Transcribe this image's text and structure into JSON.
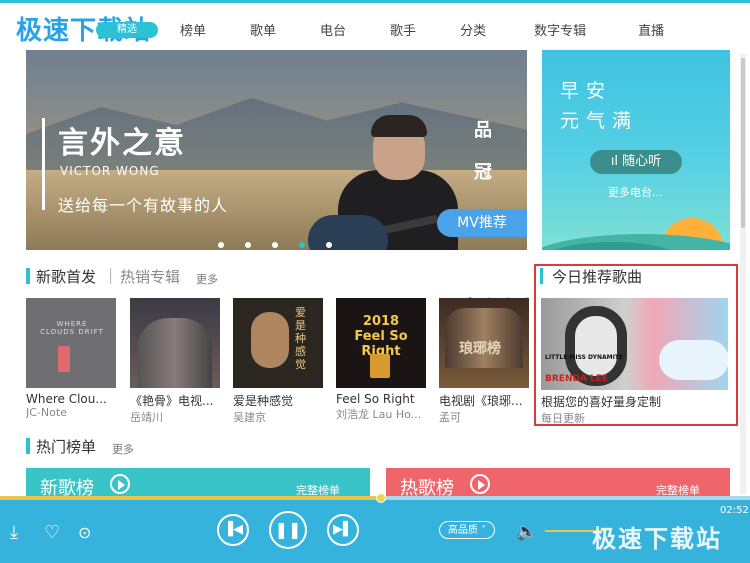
{
  "header": {
    "logo": "极速下载站",
    "logo_badge": "精选",
    "nav": [
      "榜单",
      "歌单",
      "电台",
      "歌手",
      "分类",
      "数字专辑",
      "直播"
    ]
  },
  "banner": {
    "title": "言外之意",
    "artist_en": "VICTOR WONG",
    "subtitle": "送给每一个有故事的人",
    "side_top": "品",
    "side_bottom": "冠",
    "badge": "MV推荐",
    "dots": 5,
    "active_dot": 4
  },
  "side_card": {
    "line1": "早安",
    "line2": "元气满",
    "button": "随心听",
    "more": "更多电台..."
  },
  "new_songs": {
    "tab_active": "新歌首发",
    "tab_inactive": "热销专辑",
    "more": "更多",
    "albums": [
      {
        "title": "Where Clou...",
        "artist": "JC-Note"
      },
      {
        "title": "《艳骨》电视...",
        "artist": "岳靖川"
      },
      {
        "title": "爱是种感觉",
        "artist": "吴建京"
      },
      {
        "title": "Feel So Right",
        "artist": "刘浩龙 Lau Ho..."
      },
      {
        "title": "电视剧《琅琊...",
        "artist": "孟可"
      }
    ],
    "cover_texts": [
      "WHERE CLOUDS DRIFT",
      "",
      "爱是种感觉",
      "2018 Feel So Right",
      "琅琊榜"
    ]
  },
  "recommend": {
    "title": "今日推荐歌曲",
    "cover_label1": "LITTLE MISS DYNAMITE",
    "cover_label2": "BRENDA LEE",
    "desc": "根据您的喜好量身定制",
    "sub": "每日更新"
  },
  "charts": {
    "title": "热门榜单",
    "more": "更多",
    "cards": [
      {
        "title": "新歌榜",
        "link": "完整榜单",
        "color": "#39c4c7"
      },
      {
        "title": "热歌榜",
        "link": "完整榜单",
        "color": "#f0656b"
      }
    ]
  },
  "player": {
    "time": "02:52",
    "quality": "高品质",
    "progress_fraction": 0.51,
    "watermark": "极速下载站"
  },
  "colors": {
    "accent": "#2bc2d6",
    "player": "#36b3dd",
    "highlight_border": "#d93a3a"
  }
}
